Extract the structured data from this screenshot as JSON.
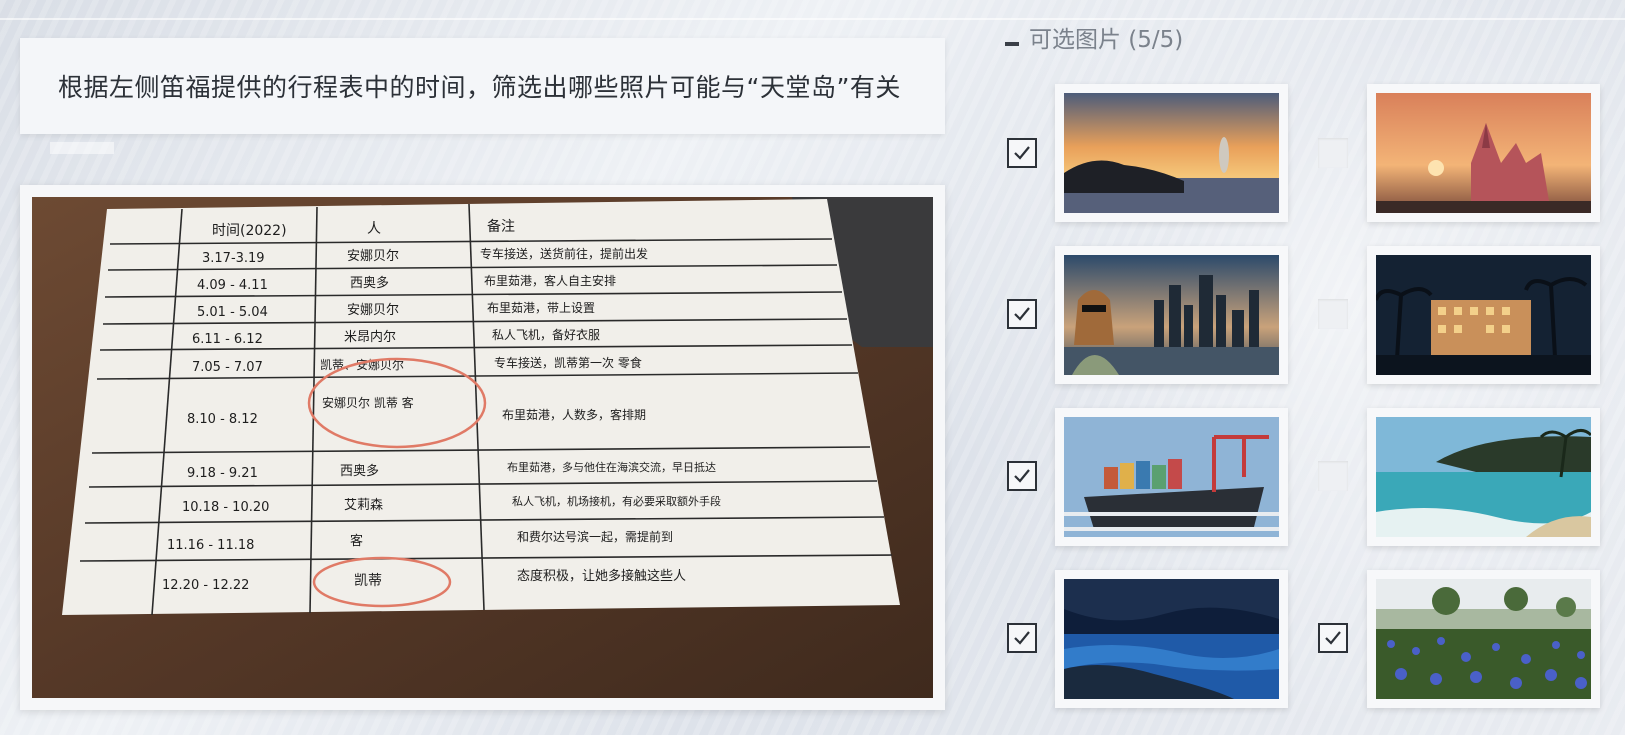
{
  "instruction": {
    "text": "根据左侧笛福提供的行程表中的时间，筛选出哪些照片可能与“天堂岛”有关"
  },
  "panel": {
    "title": "可选图片 (5/5)"
  },
  "schedule": {
    "headers": [
      "时间(2022)",
      "人",
      "备注"
    ],
    "rows": [
      {
        "time": "3.17-3.19",
        "person": "安娜贝尔",
        "note": "专车接送，送货前往，提前出发"
      },
      {
        "time": "4.09 - 4.11",
        "person": "西奥多",
        "note": "布里茹港，客人自主安排"
      },
      {
        "time": "5.01 - 5.04",
        "person": "安娜贝尔",
        "note": "布里茹港，带上设置"
      },
      {
        "time": "6.11 - 6.12",
        "person": "米昂内尔",
        "note": "私人飞机，备好衣服"
      },
      {
        "time": "7.05 - 7.07",
        "person": "凯蒂、安娜贝尔",
        "note": "专车接送，凯蒂第一次 零食"
      },
      {
        "time": "8.10 - 8.12",
        "person": "安娜贝尔 凯蒂 客",
        "note": "布里茹港，人数多，客排期"
      },
      {
        "time": "9.18 - 9.21",
        "person": "西奥多",
        "note": "布里茹港，多与他住在海滨交流，早日抵达"
      },
      {
        "time": "10.18 - 10.20",
        "person": "艾莉森",
        "note": "私人飞机，机场接机，有必要采取额外手段"
      },
      {
        "time": "11.16 - 11.18",
        "person": "客",
        "note": "和费尔达号滨一起，需提前到"
      },
      {
        "time": "12.20 - 12.22",
        "person": "凯蒂",
        "note": "态度积极，让她多接触这些人"
      }
    ]
  },
  "thumbnails": [
    {
      "name": "sunset-sea-rock",
      "checked": true
    },
    {
      "name": "pink-castle-sunset",
      "checked": false
    },
    {
      "name": "woman-city-skyline",
      "checked": true
    },
    {
      "name": "night-palm-hotel",
      "checked": false
    },
    {
      "name": "cargo-ship-port",
      "checked": true
    },
    {
      "name": "tropical-beach",
      "checked": false
    },
    {
      "name": "blue-cave-night",
      "checked": true
    },
    {
      "name": "blue-flower-field",
      "checked": true
    }
  ],
  "colors": {
    "accent": "#2c3138",
    "frame": "#f6f7f9",
    "ink": "#1e1e1e",
    "circle": "#e07a66"
  }
}
